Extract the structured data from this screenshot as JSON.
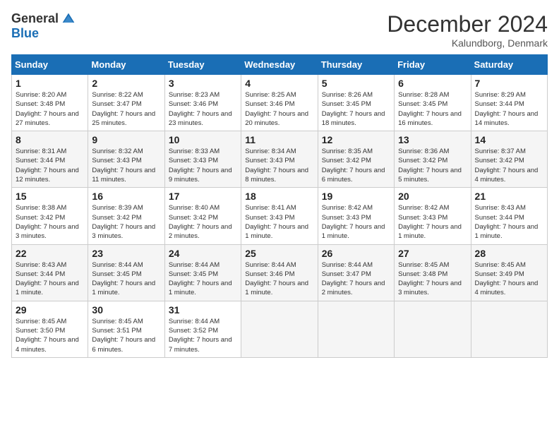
{
  "header": {
    "logo_general": "General",
    "logo_blue": "Blue",
    "title": "December 2024",
    "subtitle": "Kalundborg, Denmark"
  },
  "columns": [
    "Sunday",
    "Monday",
    "Tuesday",
    "Wednesday",
    "Thursday",
    "Friday",
    "Saturday"
  ],
  "weeks": [
    [
      {
        "day": "1",
        "sunrise": "Sunrise: 8:20 AM",
        "sunset": "Sunset: 3:48 PM",
        "daylight": "Daylight: 7 hours and 27 minutes."
      },
      {
        "day": "2",
        "sunrise": "Sunrise: 8:22 AM",
        "sunset": "Sunset: 3:47 PM",
        "daylight": "Daylight: 7 hours and 25 minutes."
      },
      {
        "day": "3",
        "sunrise": "Sunrise: 8:23 AM",
        "sunset": "Sunset: 3:46 PM",
        "daylight": "Daylight: 7 hours and 23 minutes."
      },
      {
        "day": "4",
        "sunrise": "Sunrise: 8:25 AM",
        "sunset": "Sunset: 3:46 PM",
        "daylight": "Daylight: 7 hours and 20 minutes."
      },
      {
        "day": "5",
        "sunrise": "Sunrise: 8:26 AM",
        "sunset": "Sunset: 3:45 PM",
        "daylight": "Daylight: 7 hours and 18 minutes."
      },
      {
        "day": "6",
        "sunrise": "Sunrise: 8:28 AM",
        "sunset": "Sunset: 3:45 PM",
        "daylight": "Daylight: 7 hours and 16 minutes."
      },
      {
        "day": "7",
        "sunrise": "Sunrise: 8:29 AM",
        "sunset": "Sunset: 3:44 PM",
        "daylight": "Daylight: 7 hours and 14 minutes."
      }
    ],
    [
      {
        "day": "8",
        "sunrise": "Sunrise: 8:31 AM",
        "sunset": "Sunset: 3:44 PM",
        "daylight": "Daylight: 7 hours and 12 minutes."
      },
      {
        "day": "9",
        "sunrise": "Sunrise: 8:32 AM",
        "sunset": "Sunset: 3:43 PM",
        "daylight": "Daylight: 7 hours and 11 minutes."
      },
      {
        "day": "10",
        "sunrise": "Sunrise: 8:33 AM",
        "sunset": "Sunset: 3:43 PM",
        "daylight": "Daylight: 7 hours and 9 minutes."
      },
      {
        "day": "11",
        "sunrise": "Sunrise: 8:34 AM",
        "sunset": "Sunset: 3:43 PM",
        "daylight": "Daylight: 7 hours and 8 minutes."
      },
      {
        "day": "12",
        "sunrise": "Sunrise: 8:35 AM",
        "sunset": "Sunset: 3:42 PM",
        "daylight": "Daylight: 7 hours and 6 minutes."
      },
      {
        "day": "13",
        "sunrise": "Sunrise: 8:36 AM",
        "sunset": "Sunset: 3:42 PM",
        "daylight": "Daylight: 7 hours and 5 minutes."
      },
      {
        "day": "14",
        "sunrise": "Sunrise: 8:37 AM",
        "sunset": "Sunset: 3:42 PM",
        "daylight": "Daylight: 7 hours and 4 minutes."
      }
    ],
    [
      {
        "day": "15",
        "sunrise": "Sunrise: 8:38 AM",
        "sunset": "Sunset: 3:42 PM",
        "daylight": "Daylight: 7 hours and 3 minutes."
      },
      {
        "day": "16",
        "sunrise": "Sunrise: 8:39 AM",
        "sunset": "Sunset: 3:42 PM",
        "daylight": "Daylight: 7 hours and 3 minutes."
      },
      {
        "day": "17",
        "sunrise": "Sunrise: 8:40 AM",
        "sunset": "Sunset: 3:42 PM",
        "daylight": "Daylight: 7 hours and 2 minutes."
      },
      {
        "day": "18",
        "sunrise": "Sunrise: 8:41 AM",
        "sunset": "Sunset: 3:43 PM",
        "daylight": "Daylight: 7 hours and 1 minute."
      },
      {
        "day": "19",
        "sunrise": "Sunrise: 8:42 AM",
        "sunset": "Sunset: 3:43 PM",
        "daylight": "Daylight: 7 hours and 1 minute."
      },
      {
        "day": "20",
        "sunrise": "Sunrise: 8:42 AM",
        "sunset": "Sunset: 3:43 PM",
        "daylight": "Daylight: 7 hours and 1 minute."
      },
      {
        "day": "21",
        "sunrise": "Sunrise: 8:43 AM",
        "sunset": "Sunset: 3:44 PM",
        "daylight": "Daylight: 7 hours and 1 minute."
      }
    ],
    [
      {
        "day": "22",
        "sunrise": "Sunrise: 8:43 AM",
        "sunset": "Sunset: 3:44 PM",
        "daylight": "Daylight: 7 hours and 1 minute."
      },
      {
        "day": "23",
        "sunrise": "Sunrise: 8:44 AM",
        "sunset": "Sunset: 3:45 PM",
        "daylight": "Daylight: 7 hours and 1 minute."
      },
      {
        "day": "24",
        "sunrise": "Sunrise: 8:44 AM",
        "sunset": "Sunset: 3:45 PM",
        "daylight": "Daylight: 7 hours and 1 minute."
      },
      {
        "day": "25",
        "sunrise": "Sunrise: 8:44 AM",
        "sunset": "Sunset: 3:46 PM",
        "daylight": "Daylight: 7 hours and 1 minute."
      },
      {
        "day": "26",
        "sunrise": "Sunrise: 8:44 AM",
        "sunset": "Sunset: 3:47 PM",
        "daylight": "Daylight: 7 hours and 2 minutes."
      },
      {
        "day": "27",
        "sunrise": "Sunrise: 8:45 AM",
        "sunset": "Sunset: 3:48 PM",
        "daylight": "Daylight: 7 hours and 3 minutes."
      },
      {
        "day": "28",
        "sunrise": "Sunrise: 8:45 AM",
        "sunset": "Sunset: 3:49 PM",
        "daylight": "Daylight: 7 hours and 4 minutes."
      }
    ],
    [
      {
        "day": "29",
        "sunrise": "Sunrise: 8:45 AM",
        "sunset": "Sunset: 3:50 PM",
        "daylight": "Daylight: 7 hours and 4 minutes."
      },
      {
        "day": "30",
        "sunrise": "Sunrise: 8:45 AM",
        "sunset": "Sunset: 3:51 PM",
        "daylight": "Daylight: 7 hours and 6 minutes."
      },
      {
        "day": "31",
        "sunrise": "Sunrise: 8:44 AM",
        "sunset": "Sunset: 3:52 PM",
        "daylight": "Daylight: 7 hours and 7 minutes."
      },
      null,
      null,
      null,
      null
    ]
  ]
}
